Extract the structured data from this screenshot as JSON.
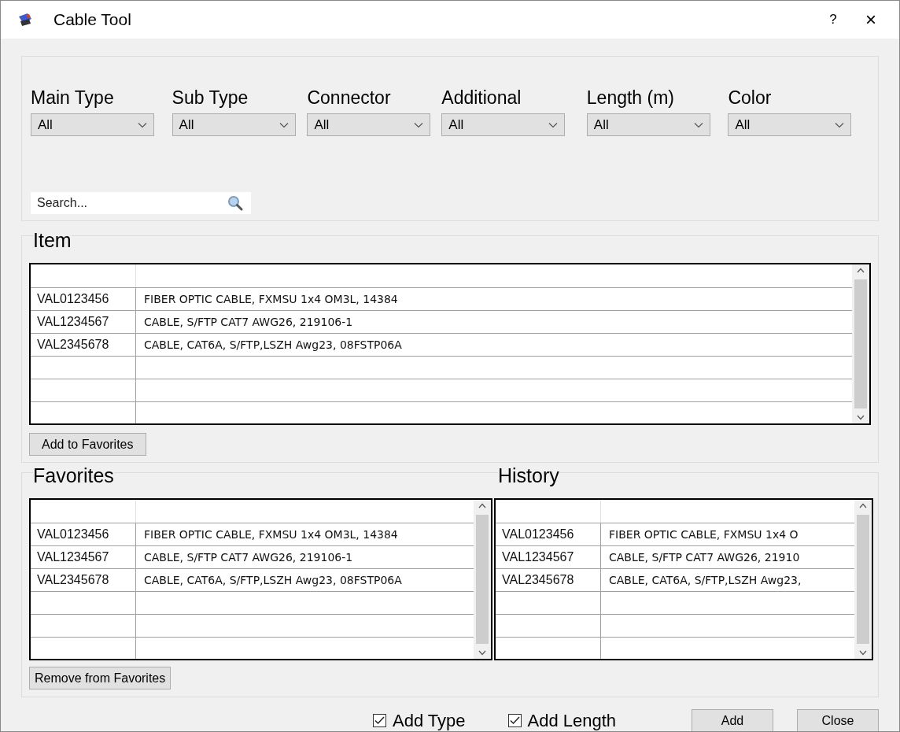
{
  "window": {
    "title": "Cable Tool",
    "help": "?",
    "close": "×"
  },
  "filters": [
    {
      "label": "Main Type",
      "value": "All"
    },
    {
      "label": "Sub Type",
      "value": "All"
    },
    {
      "label": "Connector",
      "value": "All"
    },
    {
      "label": "Additional",
      "value": "All"
    },
    {
      "label": "Length (m)",
      "value": "All"
    },
    {
      "label": "Color",
      "value": "All"
    }
  ],
  "search": {
    "placeholder": "Search..."
  },
  "item": {
    "title": "Item",
    "rows": [
      [
        "VAL0123456",
        "FIBER OPTIC CABLE, FXMSU 1x4 OM3L, 14384"
      ],
      [
        "VAL1234567",
        "CABLE, S/FTP CAT7 AWG26, 219106-1"
      ],
      [
        "VAL2345678",
        "CABLE, CAT6A, S/FTP,LSZH Awg23, 08FSTP06A"
      ]
    ],
    "button": "Add to Favorites"
  },
  "favorites": {
    "title": "Favorites",
    "rows": [
      [
        "VAL0123456",
        "FIBER OPTIC CABLE, FXMSU 1x4 OM3L, 14384"
      ],
      [
        "VAL1234567",
        "CABLE, S/FTP CAT7 AWG26, 219106-1"
      ],
      [
        "VAL2345678",
        "CABLE, CAT6A, S/FTP,LSZH Awg23, 08FSTP06A"
      ]
    ],
    "button": "Remove from Favorites"
  },
  "history": {
    "title": "History",
    "rows": [
      [
        "VAL0123456",
        "FIBER OPTIC CABLE, FXMSU 1x4 O"
      ],
      [
        "VAL1234567",
        "CABLE, S/FTP CAT7 AWG26, 21910"
      ],
      [
        "VAL2345678",
        "CABLE, CAT6A, S/FTP,LSZH Awg23,"
      ]
    ]
  },
  "options": [
    {
      "label": "Add Type",
      "checked": true
    },
    {
      "label": "Add Length",
      "checked": true
    }
  ],
  "buttons": [
    "Add",
    "Close"
  ]
}
